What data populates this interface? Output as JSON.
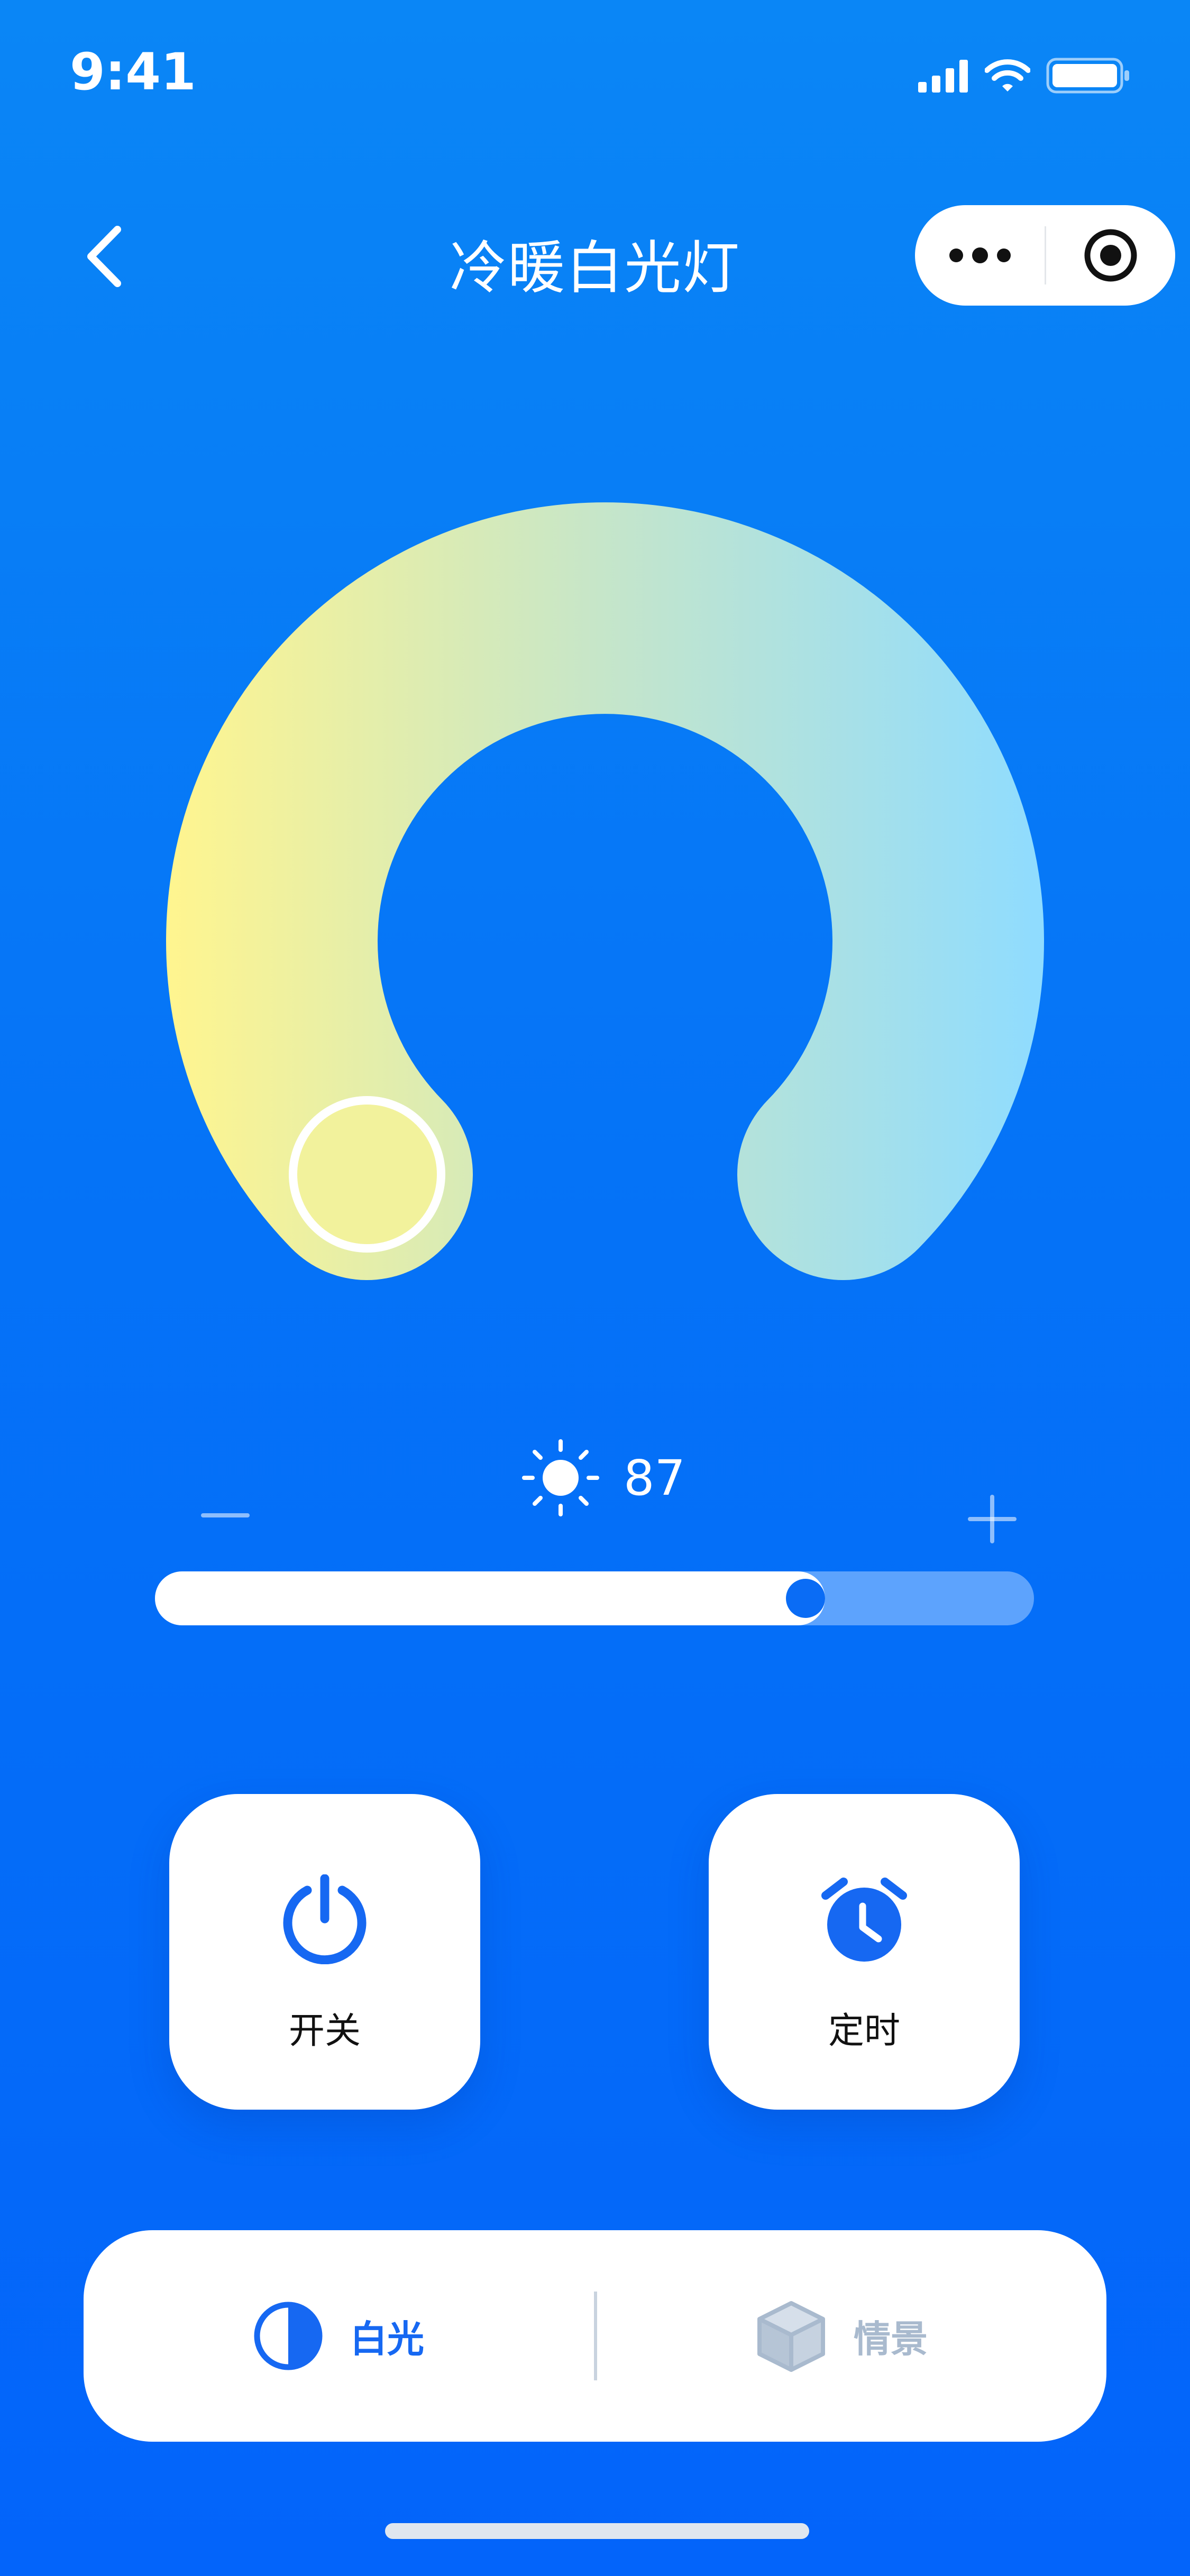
{
  "status_bar": {
    "time": "9:41"
  },
  "nav": {
    "title": "冷暖白光灯"
  },
  "color_temp": {
    "warm_color": "#FFF58F",
    "mid_color": "#C3E5CC",
    "cool_color": "#8FDCFF",
    "thumb_color": "#F2F29C"
  },
  "brightness": {
    "value": "87",
    "level": 0.74
  },
  "actions": {
    "power_label": "开关",
    "timer_label": "定时"
  },
  "tabs": [
    {
      "label": "白光",
      "icon": "half-circle-icon",
      "active": true
    },
    {
      "label": "情景",
      "icon": "cube-icon",
      "active": false
    }
  ],
  "colors": {
    "accent": "#1668F2",
    "inactive_tab": "#A9BACE",
    "background": "#0573F7"
  }
}
